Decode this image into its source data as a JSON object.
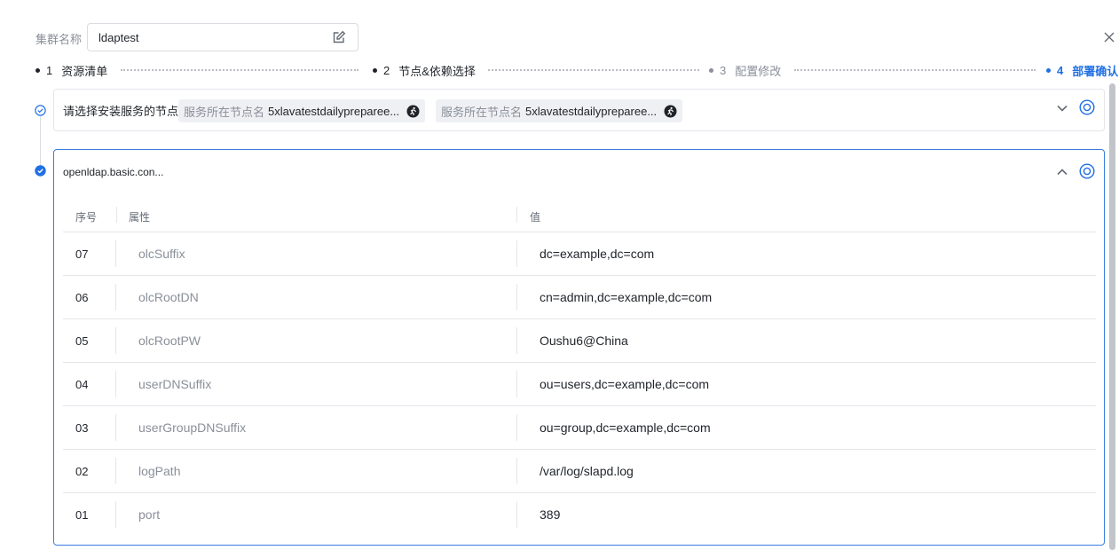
{
  "cluster": {
    "label": "集群名称",
    "name": "ldaptest"
  },
  "steps": [
    {
      "num": "1",
      "label": "资源清单"
    },
    {
      "num": "2",
      "label": "节点&依赖选择"
    },
    {
      "num": "3",
      "label": "配置修改"
    },
    {
      "num": "4",
      "label": "部署确认"
    }
  ],
  "node_card": {
    "title": "请选择安装服务的节点",
    "tags": [
      {
        "key": "服务所在节点名",
        "value": "5xlavatestdailypreparee..."
      },
      {
        "key": "服务所在节点名",
        "value": "5xlavatestdailypreparee..."
      }
    ]
  },
  "config_card": {
    "title": "openldap.basic.con...",
    "columns": [
      "序号",
      "属性",
      "值"
    ],
    "rows": [
      {
        "idx": "07",
        "attr": "olcSuffix",
        "value": "dc=example,dc=com"
      },
      {
        "idx": "06",
        "attr": "olcRootDN",
        "value": "cn=admin,dc=example,dc=com"
      },
      {
        "idx": "05",
        "attr": "olcRootPW",
        "value": "Oushu6@China"
      },
      {
        "idx": "04",
        "attr": "userDNSuffix",
        "value": "ou=users,dc=example,dc=com"
      },
      {
        "idx": "03",
        "attr": "userGroupDNSuffix",
        "value": "ou=group,dc=example,dc=com"
      },
      {
        "idx": "02",
        "attr": "logPath",
        "value": "/var/log/slapd.log"
      },
      {
        "idx": "01",
        "attr": "port",
        "value": "389"
      }
    ]
  },
  "colors": {
    "accent": "#1f6fe5",
    "muted": "#8a8f99",
    "border": "#e4e6ea"
  }
}
